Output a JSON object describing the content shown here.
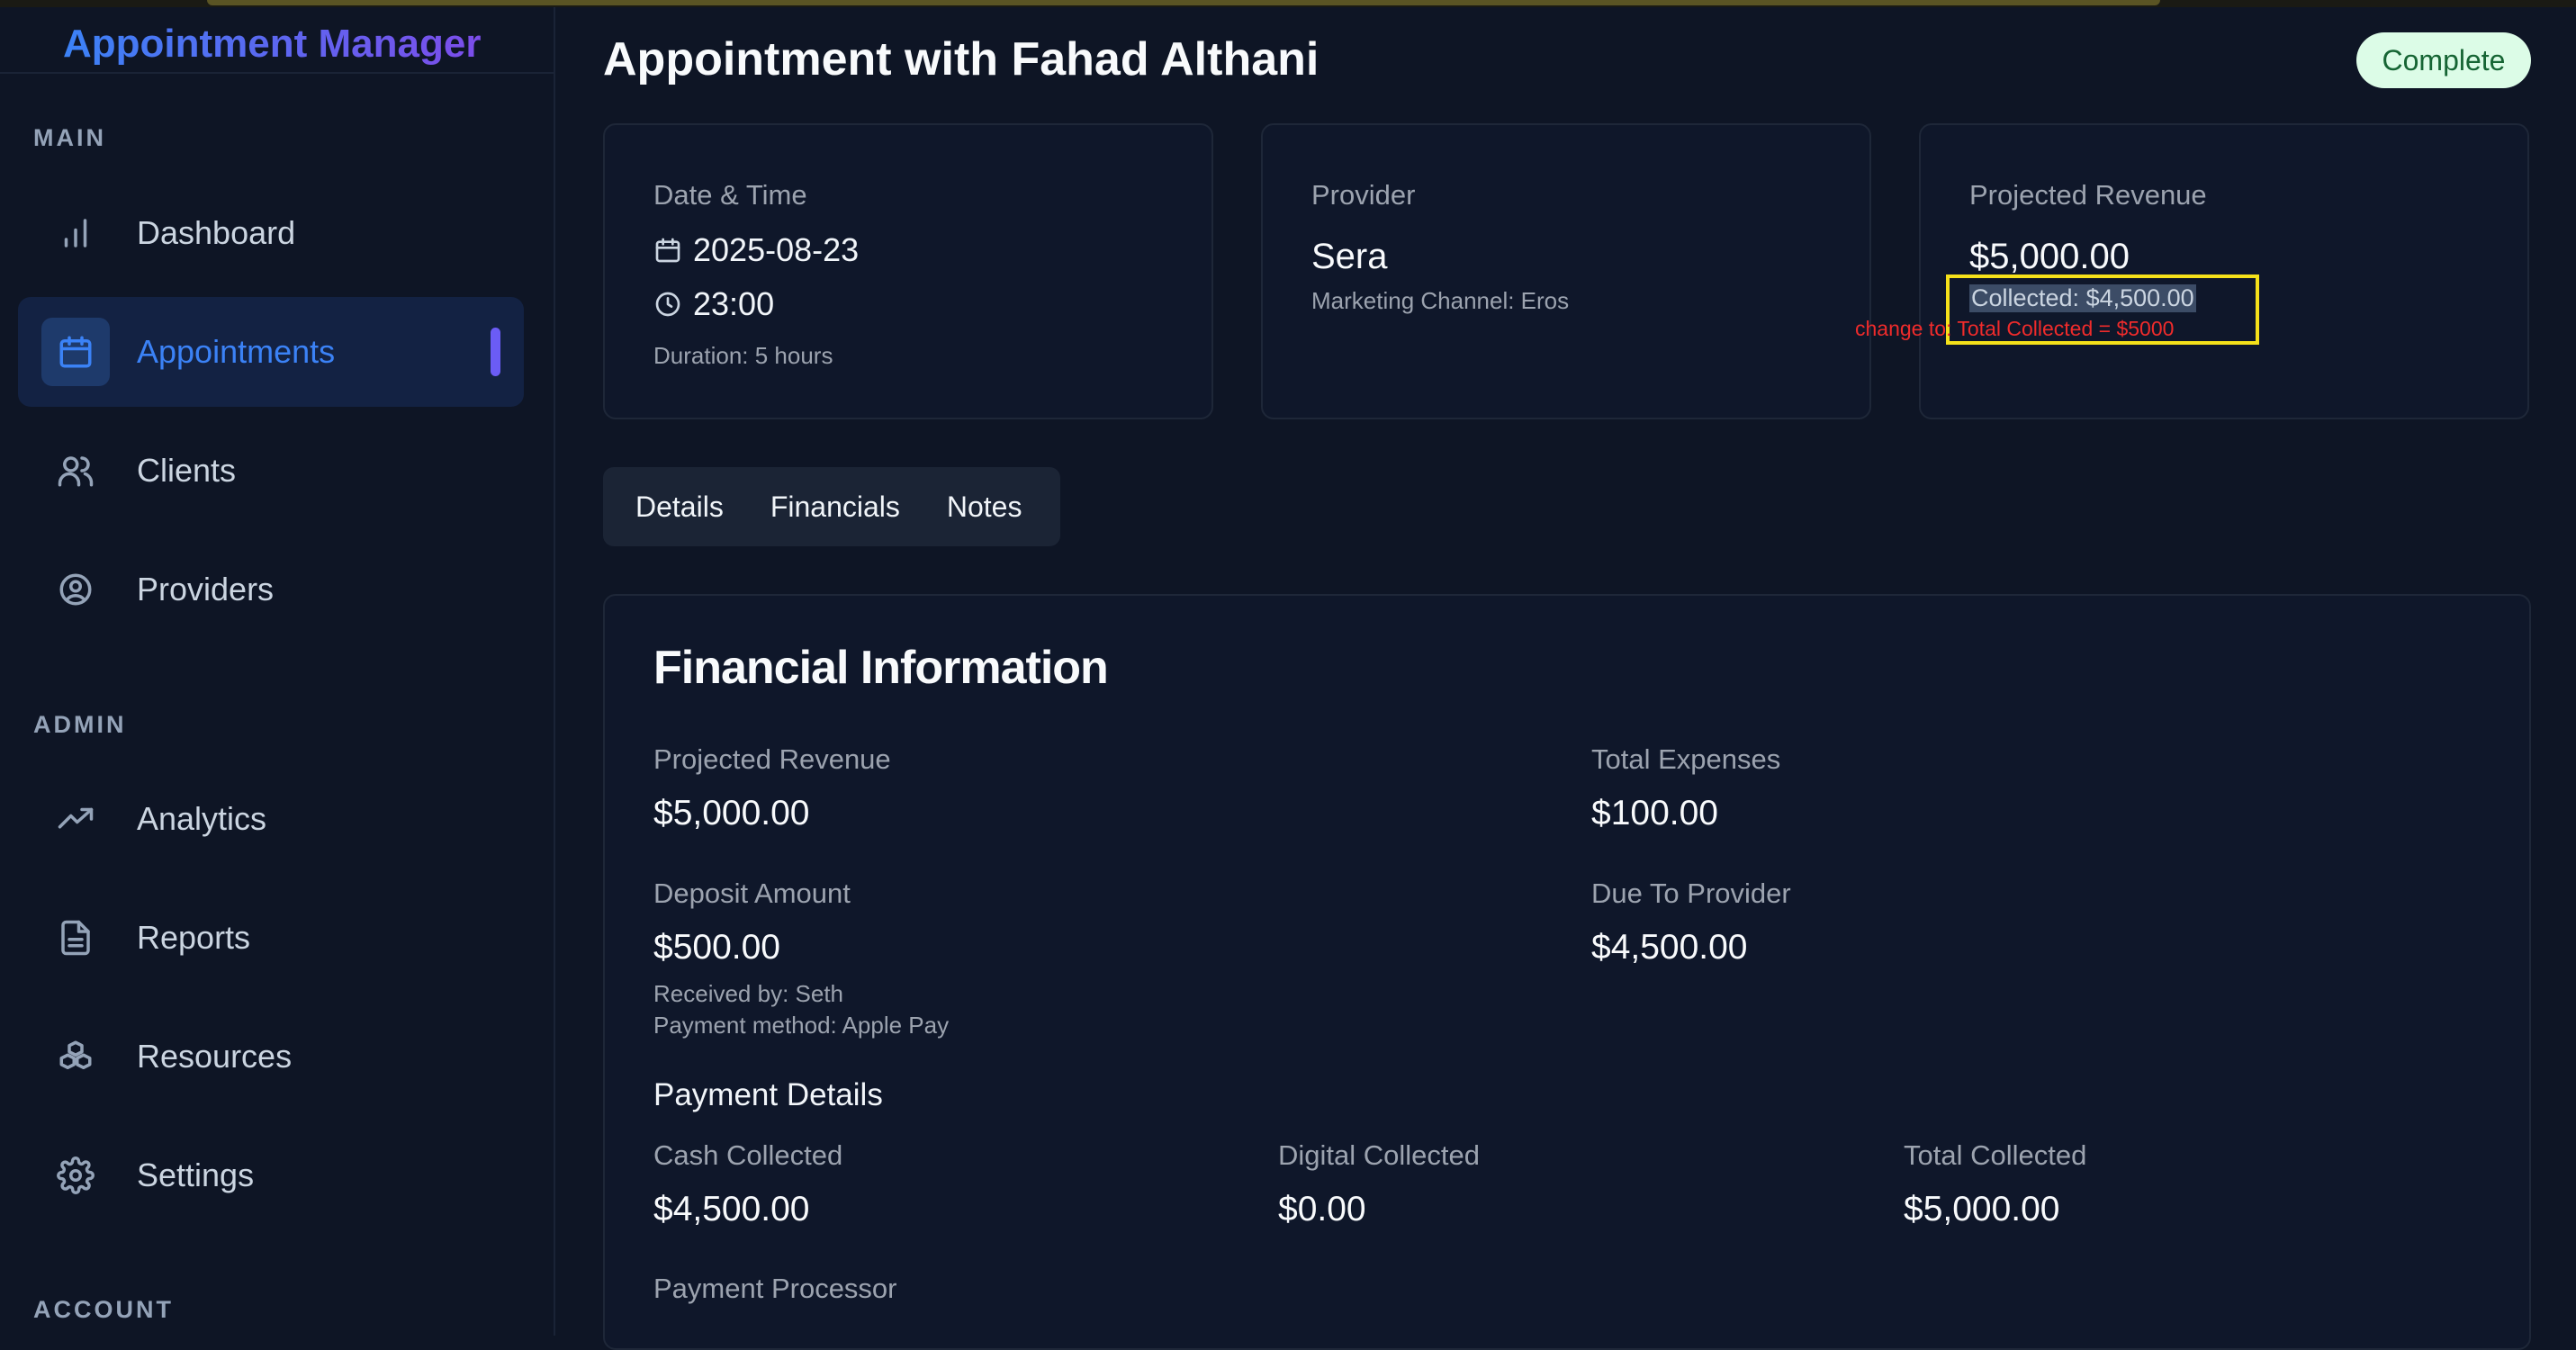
{
  "app": {
    "brand": "Appointment Manager"
  },
  "sidebar": {
    "sections": {
      "main": "MAIN",
      "admin": "ADMIN",
      "account": "ACCOUNT"
    },
    "items": [
      {
        "label": "Dashboard",
        "icon": "bar-chart-icon"
      },
      {
        "label": "Appointments",
        "icon": "calendar-icon",
        "active": true
      },
      {
        "label": "Clients",
        "icon": "users-icon"
      },
      {
        "label": "Providers",
        "icon": "user-circle-icon"
      },
      {
        "label": "Analytics",
        "icon": "trending-up-icon"
      },
      {
        "label": "Reports",
        "icon": "file-text-icon"
      },
      {
        "label": "Resources",
        "icon": "boxes-icon"
      },
      {
        "label": "Settings",
        "icon": "gear-icon"
      }
    ]
  },
  "header": {
    "title": "Appointment with Fahad Althani",
    "status": "Complete"
  },
  "cards": {
    "datetime": {
      "caption": "Date & Time",
      "date": "2025-08-23",
      "time": "23:00",
      "duration": "Duration: 5 hours"
    },
    "provider": {
      "caption": "Provider",
      "name": "Sera",
      "channel": "Marketing Channel: Eros"
    },
    "revenue": {
      "caption": "Projected Revenue",
      "amount": "$5,000.00",
      "collected": "Collected: $4,500.00"
    }
  },
  "annotation": {
    "text": "change to: Total Collected = $5000"
  },
  "tabs": [
    "Details",
    "Financials",
    "Notes"
  ],
  "financial": {
    "title": "Financial Information",
    "projected_revenue": {
      "label": "Projected Revenue",
      "value": "$5,000.00"
    },
    "total_expenses": {
      "label": "Total Expenses",
      "value": "$100.00"
    },
    "deposit": {
      "label": "Deposit Amount",
      "value": "$500.00",
      "received_by": "Received by: Seth",
      "payment_method": "Payment method: Apple Pay"
    },
    "due_provider": {
      "label": "Due To Provider",
      "value": "$4,500.00"
    },
    "payment_details": {
      "title": "Payment Details",
      "cash": {
        "label": "Cash Collected",
        "value": "$4,500.00"
      },
      "digital": {
        "label": "Digital Collected",
        "value": "$0.00"
      },
      "total": {
        "label": "Total Collected",
        "value": "$5,000.00"
      }
    },
    "processor": {
      "label": "Payment Processor"
    }
  },
  "colors": {
    "accent": "#3b82f6",
    "badge_bg": "#dcfce7",
    "badge_text": "#166534",
    "annotation_box": "#f5e11a",
    "annotation_text": "#ef2b2b"
  }
}
